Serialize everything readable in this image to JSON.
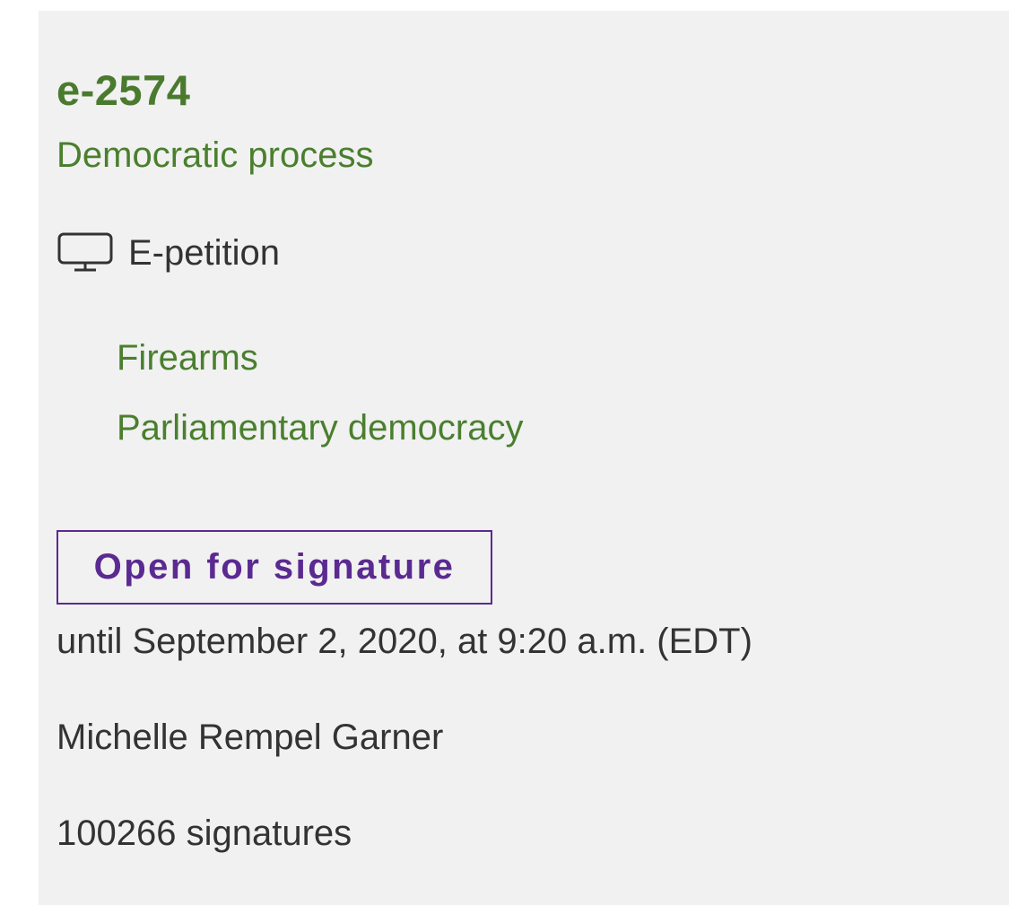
{
  "petition": {
    "id": "e-2574",
    "category": "Democratic process",
    "type_icon": "monitor-icon",
    "type_label": "E-petition",
    "topics": [
      "Firearms",
      "Parliamentary democracy"
    ],
    "status": "Open for signature",
    "deadline": "until September 2, 2020, at 9:20 a.m. (EDT)",
    "sponsor": "Michelle Rempel Garner",
    "signatures": "100266 signatures"
  },
  "colors": {
    "link_green": "#4a7f2e",
    "status_purple": "#5b2a91",
    "text_gray": "#333333",
    "card_background": "#f1f1f1"
  }
}
